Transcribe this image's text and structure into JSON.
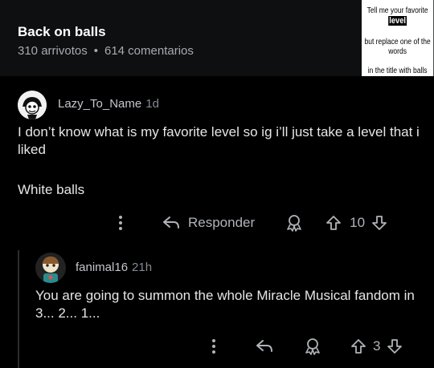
{
  "post": {
    "title": "Back on balls",
    "upvotes": "310 arrivotos",
    "comments": "614 comentarios",
    "thumbnail": {
      "line1_prefix": "Tell me your favorite ",
      "line1_highlight": "level",
      "line2": "but replace one of the words",
      "line3": "in the title with balls"
    }
  },
  "comments": [
    {
      "author": "Lazy_To_Name",
      "time": "1d",
      "text1": "I don’t know what is my favorite level so ig i’ll just take a level that i liked",
      "text2": "White balls",
      "reply_label": "Responder",
      "votes": "10"
    },
    {
      "author": "fanimal16",
      "time": "21h",
      "text1": "You are going to summon the whole Miracle Musical fandom in 3... 2... 1...",
      "votes": "3"
    }
  ]
}
